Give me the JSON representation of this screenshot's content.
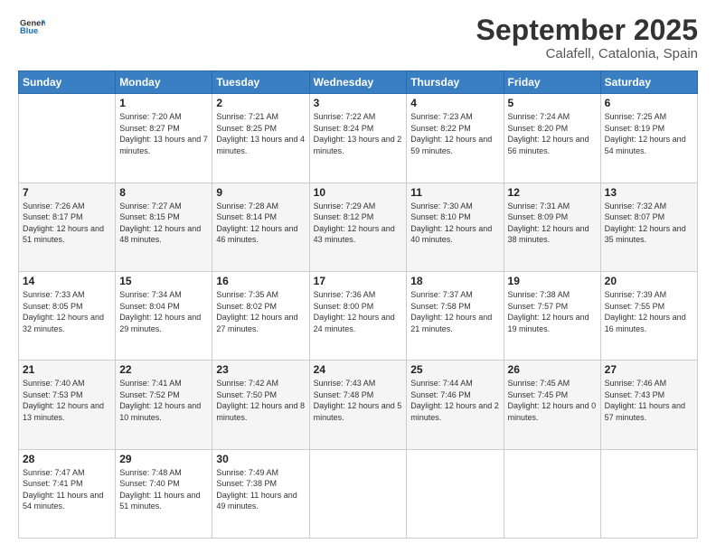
{
  "logo": {
    "line1": "General",
    "line2": "Blue"
  },
  "title": "September 2025",
  "location": "Calafell, Catalonia, Spain",
  "weekdays": [
    "Sunday",
    "Monday",
    "Tuesday",
    "Wednesday",
    "Thursday",
    "Friday",
    "Saturday"
  ],
  "weeks": [
    [
      {
        "day": "",
        "sunrise": "",
        "sunset": "",
        "daylight": ""
      },
      {
        "day": "1",
        "sunrise": "Sunrise: 7:20 AM",
        "sunset": "Sunset: 8:27 PM",
        "daylight": "Daylight: 13 hours and 7 minutes."
      },
      {
        "day": "2",
        "sunrise": "Sunrise: 7:21 AM",
        "sunset": "Sunset: 8:25 PM",
        "daylight": "Daylight: 13 hours and 4 minutes."
      },
      {
        "day": "3",
        "sunrise": "Sunrise: 7:22 AM",
        "sunset": "Sunset: 8:24 PM",
        "daylight": "Daylight: 13 hours and 2 minutes."
      },
      {
        "day": "4",
        "sunrise": "Sunrise: 7:23 AM",
        "sunset": "Sunset: 8:22 PM",
        "daylight": "Daylight: 12 hours and 59 minutes."
      },
      {
        "day": "5",
        "sunrise": "Sunrise: 7:24 AM",
        "sunset": "Sunset: 8:20 PM",
        "daylight": "Daylight: 12 hours and 56 minutes."
      },
      {
        "day": "6",
        "sunrise": "Sunrise: 7:25 AM",
        "sunset": "Sunset: 8:19 PM",
        "daylight": "Daylight: 12 hours and 54 minutes."
      }
    ],
    [
      {
        "day": "7",
        "sunrise": "Sunrise: 7:26 AM",
        "sunset": "Sunset: 8:17 PM",
        "daylight": "Daylight: 12 hours and 51 minutes."
      },
      {
        "day": "8",
        "sunrise": "Sunrise: 7:27 AM",
        "sunset": "Sunset: 8:15 PM",
        "daylight": "Daylight: 12 hours and 48 minutes."
      },
      {
        "day": "9",
        "sunrise": "Sunrise: 7:28 AM",
        "sunset": "Sunset: 8:14 PM",
        "daylight": "Daylight: 12 hours and 46 minutes."
      },
      {
        "day": "10",
        "sunrise": "Sunrise: 7:29 AM",
        "sunset": "Sunset: 8:12 PM",
        "daylight": "Daylight: 12 hours and 43 minutes."
      },
      {
        "day": "11",
        "sunrise": "Sunrise: 7:30 AM",
        "sunset": "Sunset: 8:10 PM",
        "daylight": "Daylight: 12 hours and 40 minutes."
      },
      {
        "day": "12",
        "sunrise": "Sunrise: 7:31 AM",
        "sunset": "Sunset: 8:09 PM",
        "daylight": "Daylight: 12 hours and 38 minutes."
      },
      {
        "day": "13",
        "sunrise": "Sunrise: 7:32 AM",
        "sunset": "Sunset: 8:07 PM",
        "daylight": "Daylight: 12 hours and 35 minutes."
      }
    ],
    [
      {
        "day": "14",
        "sunrise": "Sunrise: 7:33 AM",
        "sunset": "Sunset: 8:05 PM",
        "daylight": "Daylight: 12 hours and 32 minutes."
      },
      {
        "day": "15",
        "sunrise": "Sunrise: 7:34 AM",
        "sunset": "Sunset: 8:04 PM",
        "daylight": "Daylight: 12 hours and 29 minutes."
      },
      {
        "day": "16",
        "sunrise": "Sunrise: 7:35 AM",
        "sunset": "Sunset: 8:02 PM",
        "daylight": "Daylight: 12 hours and 27 minutes."
      },
      {
        "day": "17",
        "sunrise": "Sunrise: 7:36 AM",
        "sunset": "Sunset: 8:00 PM",
        "daylight": "Daylight: 12 hours and 24 minutes."
      },
      {
        "day": "18",
        "sunrise": "Sunrise: 7:37 AM",
        "sunset": "Sunset: 7:58 PM",
        "daylight": "Daylight: 12 hours and 21 minutes."
      },
      {
        "day": "19",
        "sunrise": "Sunrise: 7:38 AM",
        "sunset": "Sunset: 7:57 PM",
        "daylight": "Daylight: 12 hours and 19 minutes."
      },
      {
        "day": "20",
        "sunrise": "Sunrise: 7:39 AM",
        "sunset": "Sunset: 7:55 PM",
        "daylight": "Daylight: 12 hours and 16 minutes."
      }
    ],
    [
      {
        "day": "21",
        "sunrise": "Sunrise: 7:40 AM",
        "sunset": "Sunset: 7:53 PM",
        "daylight": "Daylight: 12 hours and 13 minutes."
      },
      {
        "day": "22",
        "sunrise": "Sunrise: 7:41 AM",
        "sunset": "Sunset: 7:52 PM",
        "daylight": "Daylight: 12 hours and 10 minutes."
      },
      {
        "day": "23",
        "sunrise": "Sunrise: 7:42 AM",
        "sunset": "Sunset: 7:50 PM",
        "daylight": "Daylight: 12 hours and 8 minutes."
      },
      {
        "day": "24",
        "sunrise": "Sunrise: 7:43 AM",
        "sunset": "Sunset: 7:48 PM",
        "daylight": "Daylight: 12 hours and 5 minutes."
      },
      {
        "day": "25",
        "sunrise": "Sunrise: 7:44 AM",
        "sunset": "Sunset: 7:46 PM",
        "daylight": "Daylight: 12 hours and 2 minutes."
      },
      {
        "day": "26",
        "sunrise": "Sunrise: 7:45 AM",
        "sunset": "Sunset: 7:45 PM",
        "daylight": "Daylight: 12 hours and 0 minutes."
      },
      {
        "day": "27",
        "sunrise": "Sunrise: 7:46 AM",
        "sunset": "Sunset: 7:43 PM",
        "daylight": "Daylight: 11 hours and 57 minutes."
      }
    ],
    [
      {
        "day": "28",
        "sunrise": "Sunrise: 7:47 AM",
        "sunset": "Sunset: 7:41 PM",
        "daylight": "Daylight: 11 hours and 54 minutes."
      },
      {
        "day": "29",
        "sunrise": "Sunrise: 7:48 AM",
        "sunset": "Sunset: 7:40 PM",
        "daylight": "Daylight: 11 hours and 51 minutes."
      },
      {
        "day": "30",
        "sunrise": "Sunrise: 7:49 AM",
        "sunset": "Sunset: 7:38 PM",
        "daylight": "Daylight: 11 hours and 49 minutes."
      },
      {
        "day": "",
        "sunrise": "",
        "sunset": "",
        "daylight": ""
      },
      {
        "day": "",
        "sunrise": "",
        "sunset": "",
        "daylight": ""
      },
      {
        "day": "",
        "sunrise": "",
        "sunset": "",
        "daylight": ""
      },
      {
        "day": "",
        "sunrise": "",
        "sunset": "",
        "daylight": ""
      }
    ]
  ]
}
